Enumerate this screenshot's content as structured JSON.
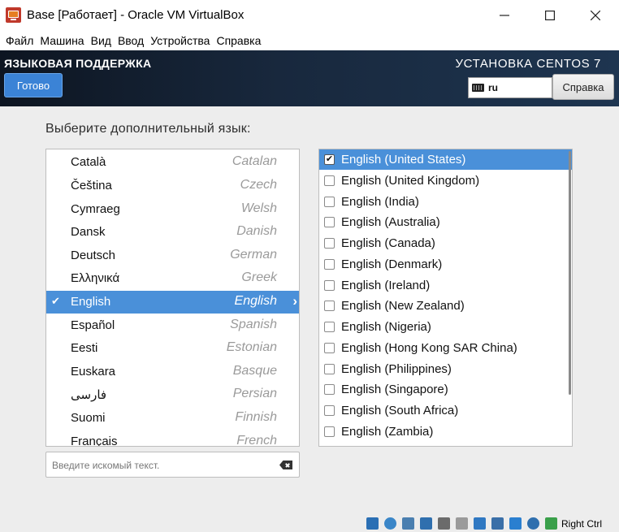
{
  "window": {
    "title": "Base [Работает] - Oracle VM VirtualBox",
    "minimize": "—",
    "maximize": "☐",
    "close": "✕"
  },
  "menu": [
    "Файл",
    "Машина",
    "Вид",
    "Ввод",
    "Устройства",
    "Справка"
  ],
  "header": {
    "spoke_title": "ЯЗЫКОВАЯ ПОДДЕРЖКА",
    "done_label": "Готово",
    "install_title": "УСТАНОВКА CENTOS 7",
    "keyboard_layout": "ru",
    "help_label": "Справка"
  },
  "main": {
    "prompt": "Выберите дополнительный язык:",
    "search_placeholder": "Введите искомый текст."
  },
  "languages": [
    {
      "native": "Català",
      "english": "Catalan"
    },
    {
      "native": "Čeština",
      "english": "Czech"
    },
    {
      "native": "Cymraeg",
      "english": "Welsh"
    },
    {
      "native": "Dansk",
      "english": "Danish"
    },
    {
      "native": "Deutsch",
      "english": "German"
    },
    {
      "native": "Ελληνικά",
      "english": "Greek"
    },
    {
      "native": "English",
      "english": "English",
      "selected": true
    },
    {
      "native": "Español",
      "english": "Spanish"
    },
    {
      "native": "Eesti",
      "english": "Estonian"
    },
    {
      "native": "Euskara",
      "english": "Basque"
    },
    {
      "native": "فارسی",
      "english": "Persian"
    },
    {
      "native": "Suomi",
      "english": "Finnish"
    },
    {
      "native": "Français",
      "english": "French"
    }
  ],
  "locales": [
    {
      "label": "English (United States)",
      "checked": true,
      "selected": true
    },
    {
      "label": "English (United Kingdom)",
      "checked": false
    },
    {
      "label": "English (India)",
      "checked": false
    },
    {
      "label": "English (Australia)",
      "checked": false
    },
    {
      "label": "English (Canada)",
      "checked": false
    },
    {
      "label": "English (Denmark)",
      "checked": false
    },
    {
      "label": "English (Ireland)",
      "checked": false
    },
    {
      "label": "English (New Zealand)",
      "checked": false
    },
    {
      "label": "English (Nigeria)",
      "checked": false
    },
    {
      "label": "English (Hong Kong SAR China)",
      "checked": false
    },
    {
      "label": "English (Philippines)",
      "checked": false
    },
    {
      "label": "English (Singapore)",
      "checked": false
    },
    {
      "label": "English (South Africa)",
      "checked": false
    },
    {
      "label": "English (Zambia)",
      "checked": false
    }
  ],
  "statusbar": {
    "host_key": "Right Ctrl",
    "icons": [
      {
        "name": "hard-disk-icon",
        "color": "#2a6fb4"
      },
      {
        "name": "optical-drive-icon",
        "color": "#3a86c8"
      },
      {
        "name": "audio-icon",
        "color": "#4a7fb0"
      },
      {
        "name": "network-icon",
        "color": "#2f6fae"
      },
      {
        "name": "usb-icon",
        "color": "#6b6b6b"
      },
      {
        "name": "shared-folders-icon",
        "color": "#9a9a9a"
      },
      {
        "name": "display-icon",
        "color": "#2f78c2"
      },
      {
        "name": "recording-icon",
        "color": "#3a6fa8"
      },
      {
        "name": "cpu-icon",
        "color": "#2a7fd0"
      },
      {
        "name": "mouse-integration-icon",
        "color": "#2f6fae"
      },
      {
        "name": "arrow-download-icon",
        "color": "#3aa04a"
      }
    ]
  }
}
